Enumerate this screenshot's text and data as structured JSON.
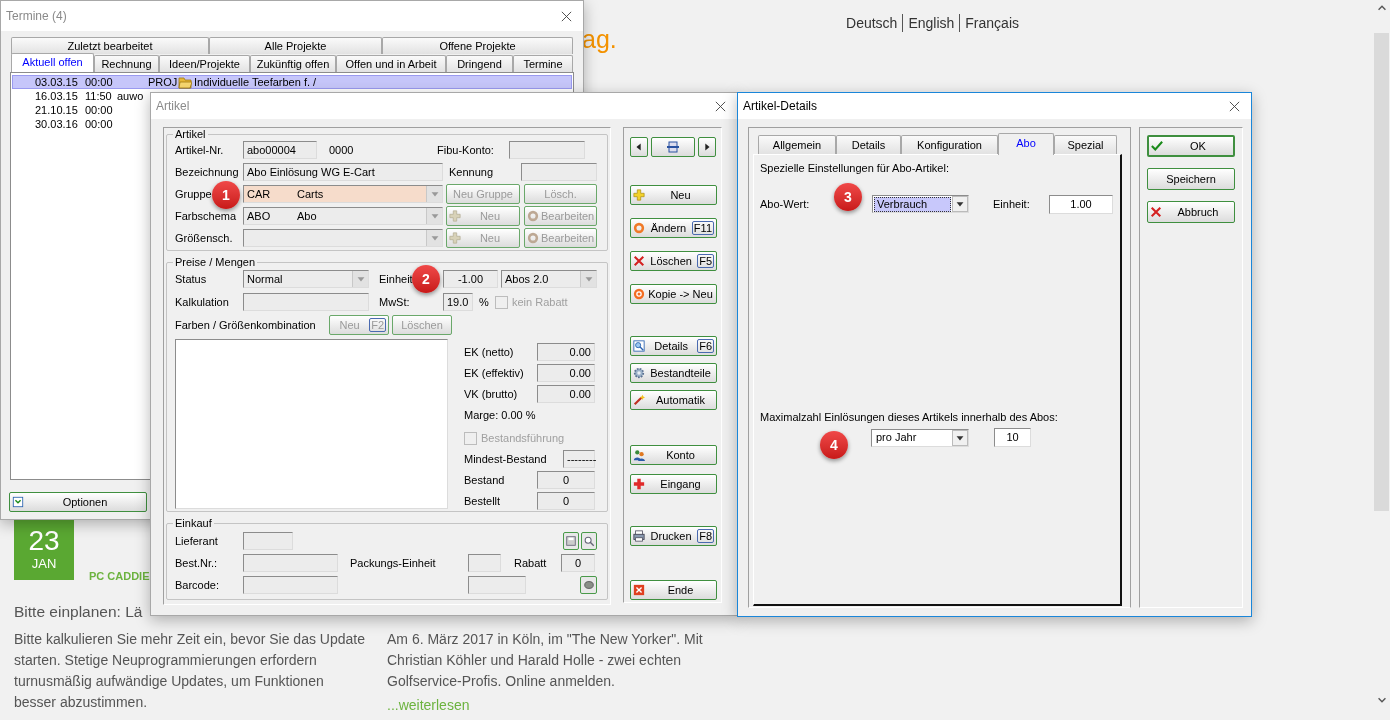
{
  "website": {
    "languages": [
      "Deutsch",
      "English",
      "Français"
    ],
    "headline_fragment": "ag.",
    "news": [
      {
        "day": "23",
        "month": "JAN",
        "source": "PC CADDIE",
        "title": "Bitte einplanen: Lä",
        "text": "Bitte kalkulieren Sie mehr Zeit ein, bevor Sie das Update starten. Stetige Neuprogrammierungen erfordern turnusmäßig aufwändige Updates, um Funktionen besser abzustimmen."
      },
      {
        "text": "Am 6. März 2017 in Köln, im \"The New Yorker\". Mit Christian Köhler und Harald Holle - zwei echten Golfservice-Profis. Online anmelden.",
        "link": "...weiterlesen"
      }
    ]
  },
  "termine_window": {
    "title": "Termine (4)",
    "tab_rows": [
      [
        {
          "label": "Zuletzt bearbeitet",
          "selected": false
        },
        {
          "label": "Alle Projekte",
          "selected": false
        },
        {
          "label": "Offene Projekte",
          "selected": false
        }
      ],
      [
        {
          "label": "Aktuell offen",
          "selected": true
        },
        {
          "label": "Rechnung",
          "selected": false
        },
        {
          "label": "Ideen/Projekte",
          "selected": false
        },
        {
          "label": "Zukünftig offen",
          "selected": false
        },
        {
          "label": "Offen und in Arbeit",
          "selected": false
        },
        {
          "label": "Dringend",
          "selected": false
        },
        {
          "label": "Termine",
          "selected": false
        }
      ]
    ],
    "rows": [
      {
        "date": "03.03.15",
        "time": "00:00",
        "type": "PROJ",
        "subject": "Individuelle Teefarben f. /",
        "selected": true
      },
      {
        "date": "16.03.15",
        "time": "11:50",
        "user": "auwo",
        "selected": false
      },
      {
        "date": "21.10.15",
        "time": "00:00",
        "selected": false
      },
      {
        "date": "30.03.16",
        "time": "00:00",
        "selected": false
      }
    ],
    "options_button": "Optionen"
  },
  "artikel_window": {
    "title": "Artikel",
    "artikel_group": {
      "legend": "Artikel",
      "artikel_nr": {
        "label": "Artikel-Nr.",
        "value": "abo00004",
        "suffix": "0000"
      },
      "fibu_konto": {
        "label": "Fibu-Konto:"
      },
      "bezeichnung": {
        "label": "Bezeichnung",
        "value": "Abo Einlösung WG E-Cart"
      },
      "kennung": {
        "label": "Kennung"
      },
      "rows": [
        {
          "label": "Gruppe",
          "code": "CAR",
          "name": "Carts",
          "focused": true,
          "buttons": [
            {
              "label": "Neu Gruppe",
              "disabled": true
            },
            {
              "label": "Lösch.",
              "disabled": true
            }
          ]
        },
        {
          "label": "Farbschema",
          "code": "ABO",
          "name": "Abo",
          "focused": false,
          "buttons": [
            {
              "label": "Neu",
              "disabled": true
            },
            {
              "label": "Bearbeiten",
              "disabled": true
            }
          ]
        },
        {
          "label": "Größensch.",
          "focused": false,
          "buttons": [
            {
              "label": "Neu",
              "disabled": true
            },
            {
              "label": "Bearbeiten",
              "disabled": true
            }
          ]
        }
      ]
    },
    "preise_group": {
      "legend": "Preise / Mengen",
      "status": {
        "label": "Status",
        "value": "Normal"
      },
      "einheit": {
        "label": "Einheit",
        "value": "-1.00",
        "unit": "Abos 2.0"
      },
      "kalkulation": {
        "label": "Kalkulation"
      },
      "mwst": {
        "label": "MwSt:",
        "value": "19.0",
        "unit": "%"
      },
      "kein_rabatt": {
        "label": "kein Rabatt",
        "checked": false,
        "disabled": true
      },
      "combinations": {
        "label": "Farben / Größenkombination",
        "buttons": [
          {
            "label": "Neu",
            "key": "F2",
            "disabled": true
          },
          {
            "label": "Löschen",
            "disabled": true
          }
        ]
      },
      "amounts": [
        {
          "label": "EK (netto)",
          "value": "0.00"
        },
        {
          "label": "EK (effektiv)",
          "value": "0.00"
        },
        {
          "label": "VK (brutto)",
          "value": "0.00"
        }
      ],
      "marge": "Marge: 0.00 %",
      "bestandsfuehrung": {
        "label": "Bestandsführung",
        "checked": false,
        "disabled": true
      },
      "stock": [
        {
          "label": "Mindest-Bestand",
          "value": "--------"
        },
        {
          "label": "Bestand",
          "value": "0"
        },
        {
          "label": "Bestellt",
          "value": "0"
        }
      ]
    },
    "einkauf_group": {
      "legend": "Einkauf",
      "lieferant": "Lieferant",
      "best_nr": "Best.Nr.:",
      "packungs_einheit": "Packungs-Einheit",
      "rabatt": {
        "label": "Rabatt",
        "value": "0"
      },
      "barcode": "Barcode:"
    },
    "side_buttons": [
      [
        {
          "label": "Neu"
        },
        {
          "label": "Ändern",
          "key": "F11"
        },
        {
          "label": "Löschen",
          "key": "F5"
        },
        {
          "label": "Kopie -> Neu"
        }
      ],
      [
        {
          "label": "Details",
          "key": "F6"
        },
        {
          "label": "Bestandteile"
        },
        {
          "label": "Automatik"
        }
      ],
      [
        {
          "label": "Konto"
        },
        {
          "label": "Eingang"
        }
      ],
      [
        {
          "label": "Drucken",
          "key": "F8"
        }
      ],
      [
        {
          "label": "Ende"
        }
      ]
    ]
  },
  "details_window": {
    "title": "Artikel-Details",
    "tabs": [
      {
        "label": "Allgemein",
        "selected": false
      },
      {
        "label": "Details",
        "selected": false
      },
      {
        "label": "Konfiguration",
        "selected": false
      },
      {
        "label": "Abo",
        "selected": true
      },
      {
        "label": "Spezial",
        "selected": false
      }
    ],
    "heading": "Spezielle Einstellungen für Abo-Artikel:",
    "abo_wert": {
      "label": "Abo-Wert:",
      "value": "Verbrauch"
    },
    "einheit": {
      "label": "Einheit:",
      "value": "1.00"
    },
    "max_label": "Maximalzahl Einlösungen dieses Artikels innerhalb des Abos:",
    "period": "pro Jahr",
    "max_value": "10",
    "buttons": [
      {
        "label": "OK",
        "default": true
      },
      {
        "label": "Speichern",
        "default": false
      },
      {
        "label": "Abbruch",
        "default": false
      }
    ]
  },
  "callouts": [
    "1",
    "2",
    "3",
    "4"
  ]
}
